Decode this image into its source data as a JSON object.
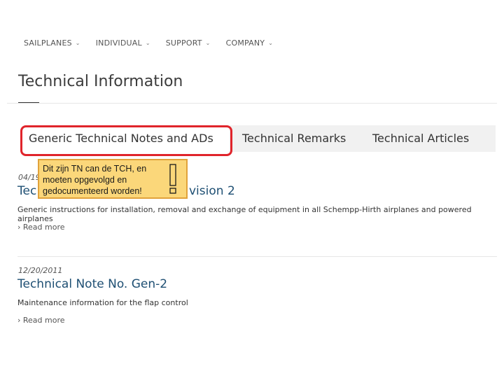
{
  "nav": {
    "items": [
      {
        "label": "SAILPLANES"
      },
      {
        "label": "INDIVIDUAL"
      },
      {
        "label": "SUPPORT"
      },
      {
        "label": "COMPANY"
      }
    ],
    "chevron": "⌄"
  },
  "page_title": "Technical Information",
  "tabs": [
    {
      "label": "Generic Technical Notes and ADs",
      "active": true
    },
    {
      "label": "Technical Remarks",
      "active": false
    },
    {
      "label": "Technical Articles",
      "active": false
    }
  ],
  "posts": [
    {
      "date": "04/19",
      "title_left": "Tec",
      "title_right": "vision 2",
      "description": "Generic instructions for installation, removal and exchange of equipment in all Schempp-Hirth airplanes and powered airplanes",
      "read_more": "› Read more"
    },
    {
      "date": "12/20/2011",
      "title": "Technical Note No. Gen-2",
      "description": "Maintenance information for the flap control",
      "read_more": "› Read more"
    }
  ],
  "annotation": {
    "text": "Dit zijn TN can de TCH, en moeten opgevolgd en gedocumenteerd worden!",
    "icon": "exclamation-icon",
    "background": "#fbd77a",
    "border": "#e1a23a"
  },
  "colors": {
    "highlight": "#e0242b",
    "link": "#1e4f73"
  }
}
